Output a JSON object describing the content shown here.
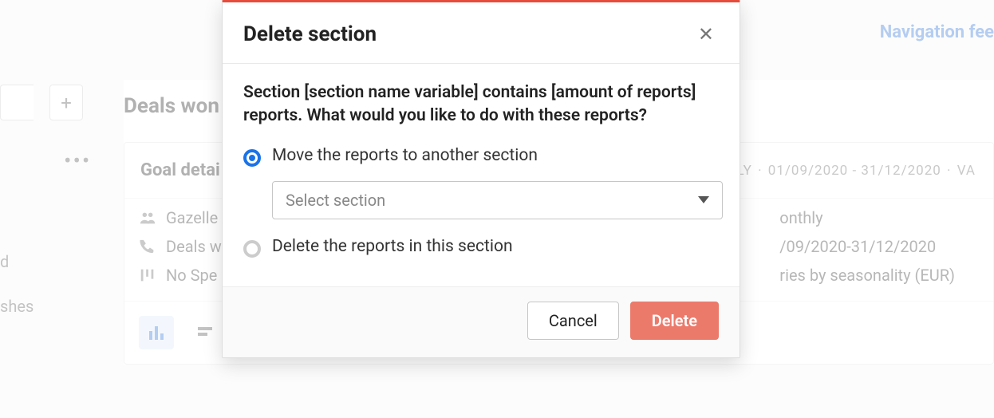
{
  "header": {
    "nav_link": "Navigation fee"
  },
  "toolbar": {
    "plus_label": "+",
    "dots": "•••"
  },
  "sidebar_fragments": {
    "line1": "d",
    "line2": "shes"
  },
  "card": {
    "title": "Deals won",
    "close_x": "✕",
    "panel_header_left": "Goal detai",
    "panel_header_right": {
      "interval": "MONTHLY",
      "dates": "01/09/2020 - 31/12/2020",
      "suffix": "VA"
    },
    "details_left": [
      {
        "icon": "people",
        "text": "Gazelle"
      },
      {
        "icon": "phone",
        "text": "Deals w"
      },
      {
        "icon": "pipeline",
        "text": "No Spe"
      }
    ],
    "details_right": [
      "onthly",
      "/09/2020-31/12/2020",
      "ries by seasonality (EUR)"
    ]
  },
  "modal": {
    "title": "Delete section",
    "close": "✕",
    "message": "Section [section name variable] contains [amount of reports] reports. What would you like to do with these reports?",
    "option_move": "Move the reports to another section",
    "option_delete": "Delete the reports in this section",
    "select_placeholder": "Select section",
    "cancel_label": "Cancel",
    "delete_label": "Delete",
    "selected_option": "move"
  }
}
